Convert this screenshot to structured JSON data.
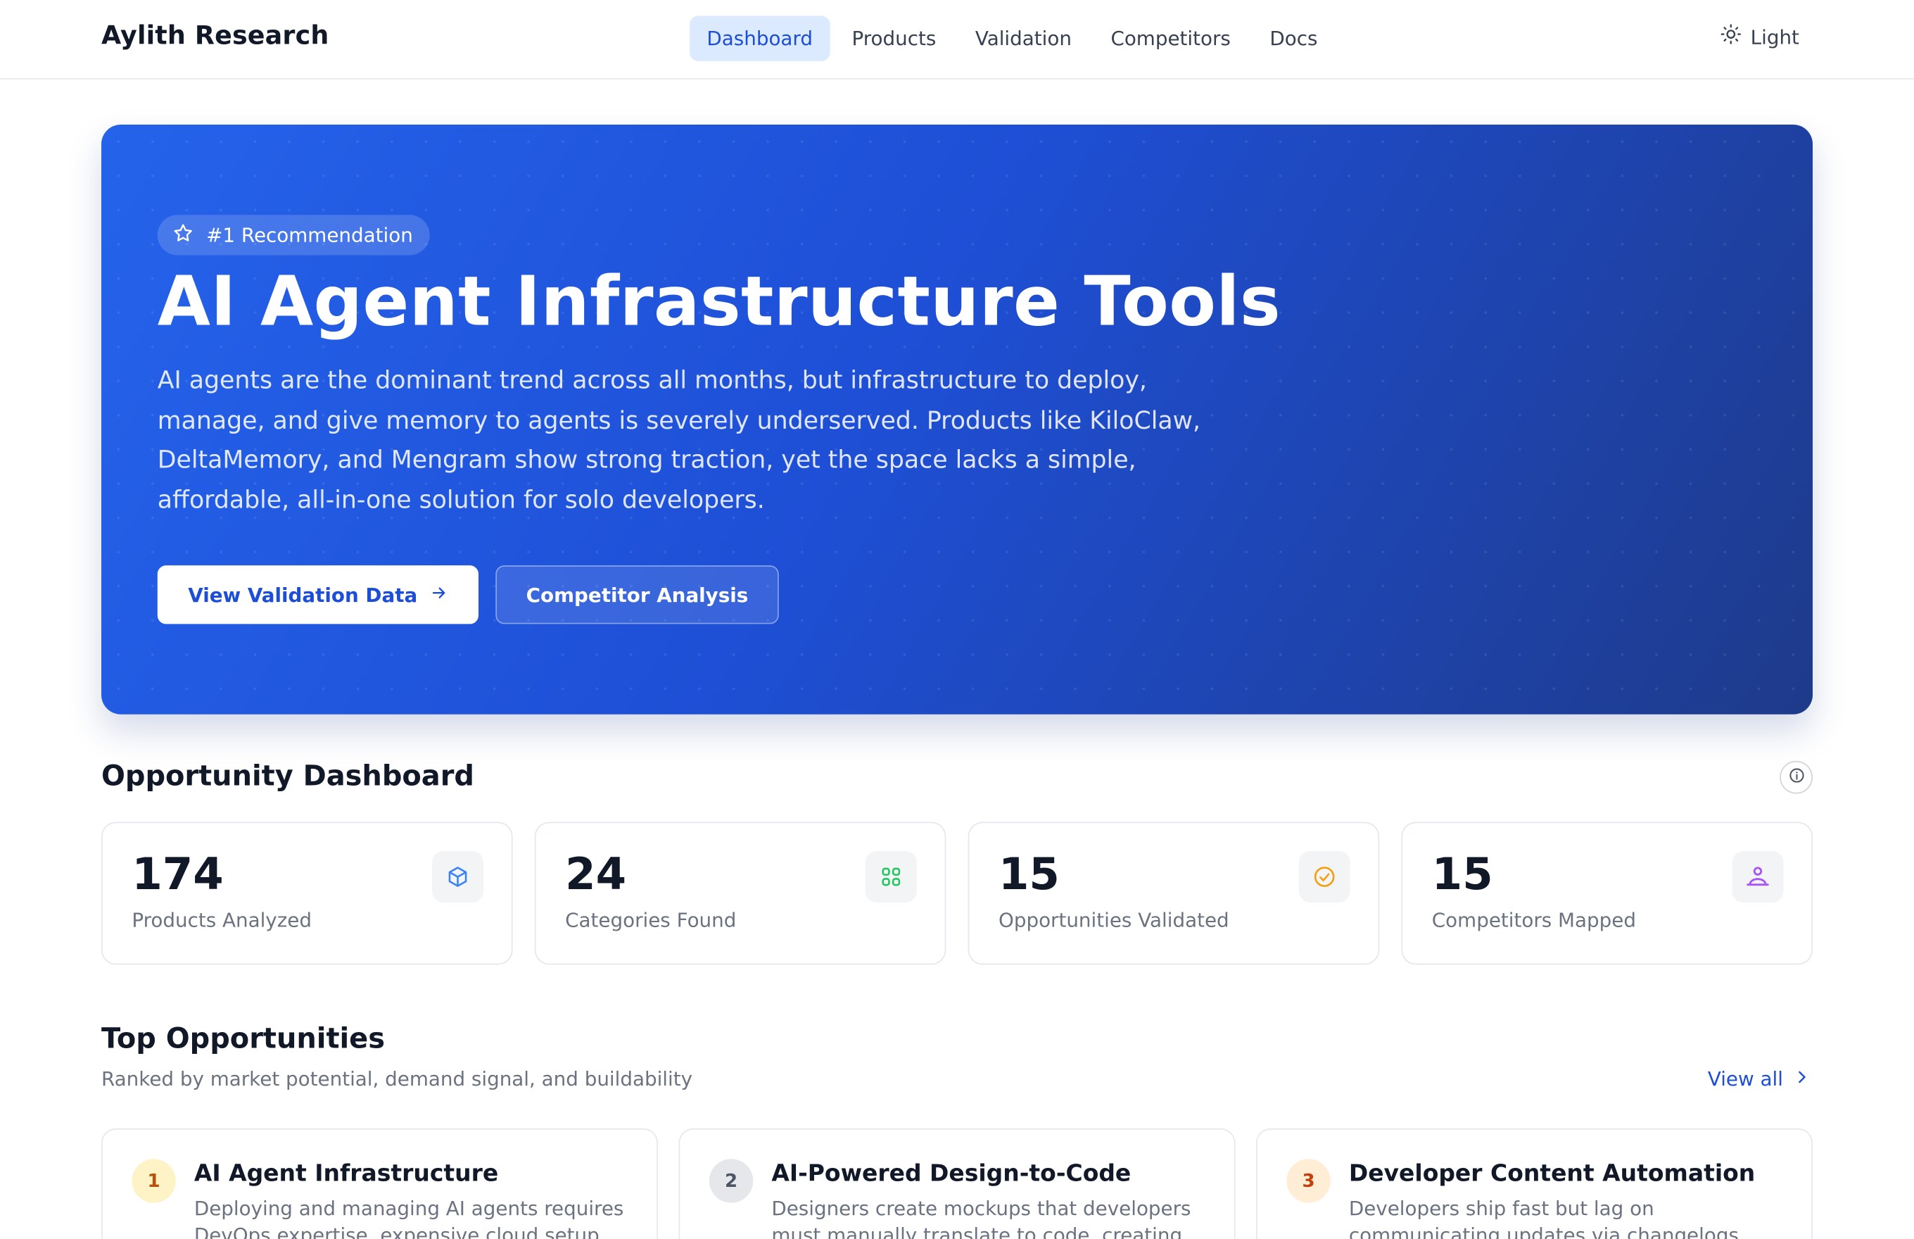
{
  "header": {
    "brand": "Aylith Research",
    "nav": [
      "Dashboard",
      "Products",
      "Validation",
      "Competitors",
      "Docs"
    ],
    "active_nav": "Dashboard",
    "theme_label": "Light",
    "theme_icon": "sun-icon"
  },
  "hero": {
    "badge": "#1 Recommendation",
    "badge_icon": "star-icon",
    "title": "AI Agent Infrastructure Tools",
    "description": "AI agents are the dominant trend across all months, but infrastructure to deploy, manage, and give memory to agents is severely underserved. Products like KiloClaw, DeltaMemory, and Mengram show strong traction, yet the space lacks a simple, affordable, all-in-one solution for solo developers.",
    "primary_button": "View Validation Data",
    "secondary_button": "Competitor Analysis",
    "colors": {
      "start": "#2563eb",
      "end": "#1e3a8a"
    }
  },
  "dashboard": {
    "title": "Opportunity Dashboard",
    "info_icon": "info-icon",
    "stats": [
      {
        "value": "174",
        "label": "Products Analyzed",
        "icon": "cube-icon",
        "color": "#3b82f6"
      },
      {
        "value": "24",
        "label": "Categories Found",
        "icon": "grid-icon",
        "color": "#22c55e"
      },
      {
        "value": "15",
        "label": "Opportunities Validated",
        "icon": "check-circle-icon",
        "color": "#f59e0b"
      },
      {
        "value": "15",
        "label": "Competitors Mapped",
        "icon": "users-icon",
        "color": "#a855f7"
      }
    ]
  },
  "opportunities": {
    "title": "Top Opportunities",
    "subtitle": "Ranked by market potential, demand signal, and buildability",
    "view_all": "View all",
    "items": [
      {
        "rank": "1",
        "title": "AI Agent Infrastructure",
        "description": "Deploying and managing AI agents requires DevOps expertise, expensive cloud setup",
        "rank_bg": "#fef3c7",
        "rank_color": "#b45309"
      },
      {
        "rank": "2",
        "title": "AI-Powered Design-to-Code",
        "description": "Designers create mockups that developers must manually translate to code, creating",
        "rank_bg": "#e5e7eb",
        "rank_color": "#4b5563"
      },
      {
        "rank": "3",
        "title": "Developer Content Automation",
        "description": "Developers ship fast but lag on communicating updates via changelogs",
        "rank_bg": "#ffedd5",
        "rank_color": "#c2410c"
      }
    ]
  }
}
